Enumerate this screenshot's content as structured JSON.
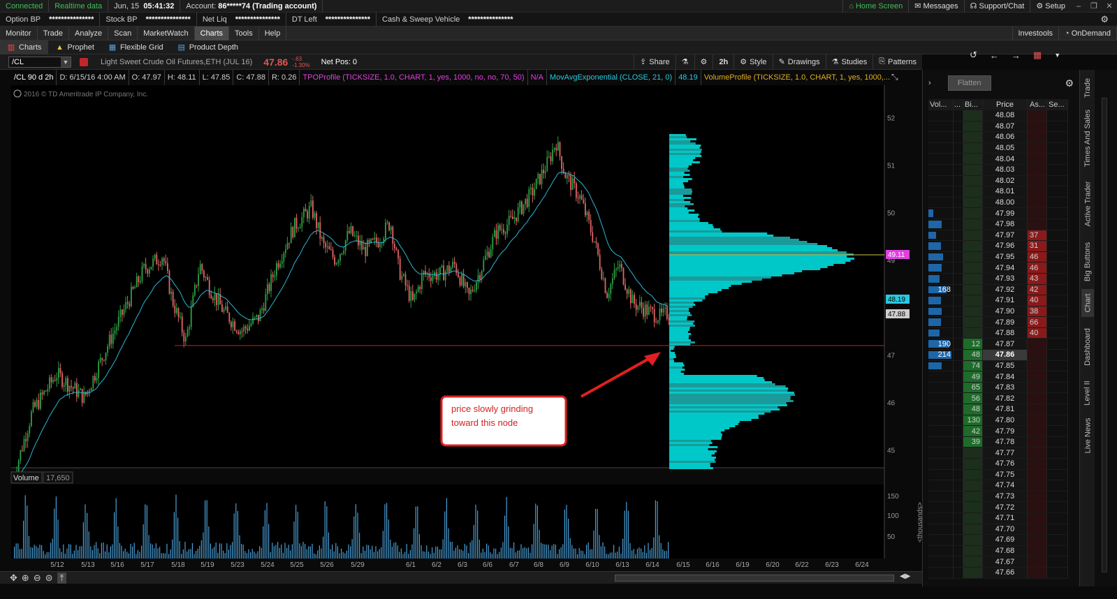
{
  "status": {
    "connected": "Connected",
    "realtime": "Realtime data",
    "date": "Jun, 15",
    "time": "05:41:32",
    "account_label": "Account:",
    "account_value": "86*****74 (Trading account)",
    "home": "Home Screen",
    "messages": "Messages",
    "support": "Support/Chat",
    "setup": "Setup"
  },
  "acct": [
    {
      "label": "Option BP",
      "value": "***************"
    },
    {
      "label": "Stock BP",
      "value": "***************"
    },
    {
      "label": "Net Liq",
      "value": "***************"
    },
    {
      "label": "DT Left",
      "value": "***************"
    },
    {
      "label": "Cash & Sweep Vehicle",
      "value": "***************"
    }
  ],
  "menu": [
    "Monitor",
    "Trade",
    "Analyze",
    "Scan",
    "MarketWatch",
    "Charts",
    "Tools",
    "Help"
  ],
  "menu_right": [
    "Investools",
    "OnDemand"
  ],
  "sub": [
    "Charts",
    "Prophet",
    "Flexible Grid",
    "Product Depth"
  ],
  "chart": {
    "symbol": "/CL",
    "description": "Light Sweet Crude Oil Futures,ETH (JUL 16)",
    "last": "47.86",
    "change": "-.63",
    "change_pct": "-1.30%",
    "netpos": "Net Pos: 0",
    "tools": [
      "Share",
      "2h",
      "Style",
      "Drawings",
      "Studies",
      "Patterns"
    ],
    "studies": [
      "/CL 90 d 2h",
      "D: 6/15/16 4:00 AM",
      "O: 47.97",
      "H: 48.11",
      "L: 47.85",
      "C: 47.88",
      "R: 0.26",
      "TPOProfile (TICKSIZE, 1.0, CHART, 1, yes, 1000, no, no, 70, 50)",
      "N/A",
      "MovAvgExponential (CLOSE, 21, 0)",
      "48.19",
      "VolumeProfile (TICKSIZE, 1.0, CHART, 1, yes, 1000,..."
    ],
    "copyright": "2016 © TD Ameritrade IP Company, Inc.",
    "annotation_l1": "price slowly grinding",
    "annotation_l2": "toward this node",
    "volume_label": "Volume",
    "volume_value": "17,650",
    "vol_unit": "<thousands>",
    "price_ticks": [
      "52",
      "51",
      "50",
      "49",
      "47",
      "46",
      "45"
    ],
    "tag_poc": "49.11",
    "tag_ema": "48.19",
    "tag_last": "47.88",
    "vol_ticks": [
      "150",
      "100",
      "50"
    ],
    "dates": [
      "5/12",
      "5/13",
      "5/16",
      "5/17",
      "5/18",
      "5/19",
      "5/23",
      "5/24",
      "5/25",
      "5/26",
      "5/29",
      "6/1",
      "6/2",
      "6/3",
      "6/6",
      "6/7",
      "6/8",
      "6/9",
      "6/10",
      "6/13",
      "6/14",
      "6/15",
      "6/16",
      "6/19",
      "6/20",
      "6/22",
      "6/23",
      "6/24"
    ]
  },
  "ladder": {
    "flatten": "Flatten",
    "headers": [
      "Vol...",
      "...",
      "Bi...",
      "Price",
      "As...",
      "Se..."
    ],
    "rows": [
      {
        "price": "48.08",
        "vol": "",
        "bid": "",
        "ask": "",
        "vbar": 0
      },
      {
        "price": "48.07",
        "vol": "",
        "bid": "",
        "ask": "",
        "vbar": 0
      },
      {
        "price": "48.06",
        "vol": "",
        "bid": "",
        "ask": "",
        "vbar": 0
      },
      {
        "price": "48.05",
        "vol": "",
        "bid": "",
        "ask": "",
        "vbar": 0
      },
      {
        "price": "48.04",
        "vol": "",
        "bid": "",
        "ask": "",
        "vbar": 0
      },
      {
        "price": "48.03",
        "vol": "",
        "bid": "",
        "ask": "",
        "vbar": 0
      },
      {
        "price": "48.02",
        "vol": "",
        "bid": "",
        "ask": "",
        "vbar": 0
      },
      {
        "price": "48.01",
        "vol": "",
        "bid": "",
        "ask": "",
        "vbar": 0
      },
      {
        "price": "48.00",
        "vol": "",
        "bid": "",
        "ask": "",
        "vbar": 0
      },
      {
        "price": "47.99",
        "vol": "",
        "bid": "",
        "ask": "",
        "vbar": 0.2
      },
      {
        "price": "47.98",
        "vol": "",
        "bid": "",
        "ask": "",
        "vbar": 0.55
      },
      {
        "price": "47.97",
        "vol": "",
        "bid": "",
        "ask": "37",
        "vbar": 0.3
      },
      {
        "price": "47.96",
        "vol": "",
        "bid": "",
        "ask": "31",
        "vbar": 0.5
      },
      {
        "price": "47.95",
        "vol": "",
        "bid": "",
        "ask": "46",
        "vbar": 0.6
      },
      {
        "price": "47.94",
        "vol": "",
        "bid": "",
        "ask": "46",
        "vbar": 0.55
      },
      {
        "price": "47.93",
        "vol": "",
        "bid": "",
        "ask": "43",
        "vbar": 0.45
      },
      {
        "price": "47.92",
        "vol": "168",
        "bid": "",
        "ask": "42",
        "vbar": 0.75
      },
      {
        "price": "47.91",
        "vol": "",
        "bid": "",
        "ask": "40",
        "vbar": 0.5
      },
      {
        "price": "47.90",
        "vol": "",
        "bid": "",
        "ask": "38",
        "vbar": 0.55
      },
      {
        "price": "47.89",
        "vol": "",
        "bid": "",
        "ask": "66",
        "vbar": 0.5
      },
      {
        "price": "47.88",
        "vol": "",
        "bid": "",
        "ask": "40",
        "vbar": 0.45
      },
      {
        "price": "47.87",
        "vol": "190",
        "bid": "12",
        "ask": "",
        "vbar": 0.85
      },
      {
        "price": "47.86",
        "vol": "214",
        "bid": "48",
        "ask": "",
        "vbar": 0.95
      },
      {
        "price": "47.85",
        "vol": "",
        "bid": "74",
        "ask": "",
        "vbar": 0.55
      },
      {
        "price": "47.84",
        "vol": "",
        "bid": "49",
        "ask": "",
        "vbar": 0
      },
      {
        "price": "47.83",
        "vol": "",
        "bid": "65",
        "ask": "",
        "vbar": 0
      },
      {
        "price": "47.82",
        "vol": "",
        "bid": "56",
        "ask": "",
        "vbar": 0
      },
      {
        "price": "47.81",
        "vol": "",
        "bid": "48",
        "ask": "",
        "vbar": 0
      },
      {
        "price": "47.80",
        "vol": "",
        "bid": "130",
        "ask": "",
        "vbar": 0
      },
      {
        "price": "47.79",
        "vol": "",
        "bid": "42",
        "ask": "",
        "vbar": 0
      },
      {
        "price": "47.78",
        "vol": "",
        "bid": "39",
        "ask": "",
        "vbar": 0
      },
      {
        "price": "47.77",
        "vol": "",
        "bid": "",
        "ask": "",
        "vbar": 0
      },
      {
        "price": "47.76",
        "vol": "",
        "bid": "",
        "ask": "",
        "vbar": 0
      },
      {
        "price": "47.75",
        "vol": "",
        "bid": "",
        "ask": "",
        "vbar": 0
      },
      {
        "price": "47.74",
        "vol": "",
        "bid": "",
        "ask": "",
        "vbar": 0
      },
      {
        "price": "47.73",
        "vol": "",
        "bid": "",
        "ask": "",
        "vbar": 0
      },
      {
        "price": "47.72",
        "vol": "",
        "bid": "",
        "ask": "",
        "vbar": 0
      },
      {
        "price": "47.71",
        "vol": "",
        "bid": "",
        "ask": "",
        "vbar": 0
      },
      {
        "price": "47.70",
        "vol": "",
        "bid": "",
        "ask": "",
        "vbar": 0
      },
      {
        "price": "47.69",
        "vol": "",
        "bid": "",
        "ask": "",
        "vbar": 0
      },
      {
        "price": "47.68",
        "vol": "",
        "bid": "",
        "ask": "",
        "vbar": 0
      },
      {
        "price": "47.67",
        "vol": "",
        "bid": "",
        "ask": "",
        "vbar": 0
      },
      {
        "price": "47.66",
        "vol": "",
        "bid": "",
        "ask": "",
        "vbar": 0
      }
    ],
    "current_price": "47.86"
  },
  "side_tabs": [
    "Trade",
    "Times And Sales",
    "Active Trader",
    "Big Buttons",
    "Chart",
    "Dashboard",
    "Level II",
    "Live News"
  ],
  "colors": {
    "up": "#2ea043",
    "down": "#e06666",
    "profile": "#00c8c8",
    "profile_dark": "#1a9a9a",
    "ema": "#2ab7d6",
    "annotation": "#e02020"
  }
}
